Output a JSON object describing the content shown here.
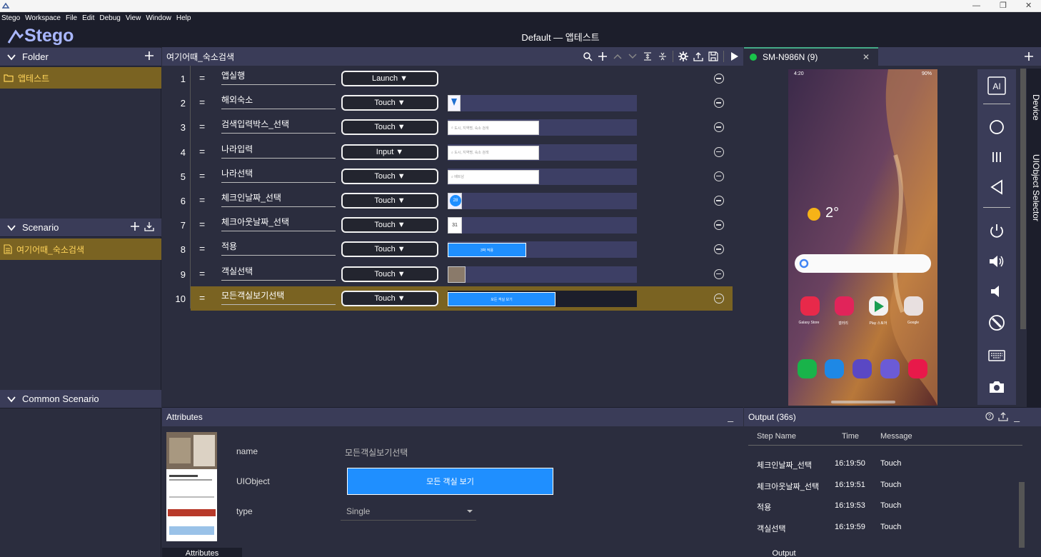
{
  "menu": [
    "Stego",
    "Workspace",
    "File",
    "Edit",
    "Debug",
    "View",
    "Window",
    "Help"
  ],
  "app": {
    "logo_text": "Stego",
    "window_title": "Default — 앱테스트"
  },
  "left": {
    "folder_header": "Folder",
    "folder_selected": "앱테스트",
    "scenario_header": "Scenario",
    "scenario_selected": "여기어때_숙소검색",
    "common_header": "Common Scenario"
  },
  "editor": {
    "title": "여기어때_숙소검색",
    "steps": [
      {
        "n": "1",
        "name": "앱실행",
        "action": "Launch ▼",
        "thumb": "none"
      },
      {
        "n": "2",
        "name": "해외숙소",
        "action": "Touch ▼",
        "thumb": "icon"
      },
      {
        "n": "3",
        "name": "검색입력박스_선택",
        "action": "Touch ▼",
        "thumb": "search",
        "thumb_text": "도시, 지역명, 숙소 검색"
      },
      {
        "n": "4",
        "name": "나라입력",
        "action": "Input ▼",
        "thumb": "search",
        "thumb_text": "도시, 지역명, 숙소 검색"
      },
      {
        "n": "5",
        "name": "나라선택",
        "action": "Touch ▼",
        "thumb": "search",
        "thumb_text": "베트남"
      },
      {
        "n": "6",
        "name": "체크인날짜_선택",
        "action": "Touch ▼",
        "thumb": "circle",
        "thumb_text": "28"
      },
      {
        "n": "7",
        "name": "체크아웃날짜_선택",
        "action": "Touch ▼",
        "thumb": "day",
        "thumb_text": "31"
      },
      {
        "n": "8",
        "name": "적용",
        "action": "Touch ▼",
        "thumb": "bluebtn",
        "thumb_text": "3박 적용"
      },
      {
        "n": "9",
        "name": "객실선택",
        "action": "Touch ▼",
        "thumb": "photo"
      },
      {
        "n": "10",
        "name": "모든객실보기선택",
        "action": "Touch ▼",
        "thumb": "bluebtn2",
        "thumb_text": "모든 객실 보기"
      }
    ]
  },
  "device": {
    "tab": "SM-N986N  (9)",
    "side_tabs": [
      "Device",
      "UIObject Selector"
    ],
    "phone": {
      "status_time": "4:20",
      "battery": "90%",
      "weather": "2°",
      "apps_row": [
        "Galaxy Store",
        "갤러리",
        "Play 스토어",
        "Google"
      ]
    }
  },
  "attributes": {
    "header": "Attributes",
    "name_label": "name",
    "name_value": "모든객실보기선택",
    "uiobject_label": "UIObject",
    "uiobject_button": "모든 객실 보기",
    "type_label": "type",
    "type_value": "Single",
    "tab": "Attributes"
  },
  "output": {
    "header": "Output  (36s)",
    "columns": [
      "Step Name",
      "Time",
      "Message"
    ],
    "rows": [
      {
        "step": "체크인날짜_선택",
        "time": "16:19:50",
        "msg": "Touch"
      },
      {
        "step": "체크아웃날짜_선택",
        "time": "16:19:51",
        "msg": "Touch"
      },
      {
        "step": "적용",
        "time": "16:19:53",
        "msg": "Touch"
      },
      {
        "step": "객실선택",
        "time": "16:19:59",
        "msg": "Touch"
      }
    ],
    "tab": "Output"
  },
  "colors": {
    "accent": "#7a6322",
    "selected_text": "#ffd45a",
    "button_blue": "#1f8fff",
    "panel": "#3a3c58"
  }
}
